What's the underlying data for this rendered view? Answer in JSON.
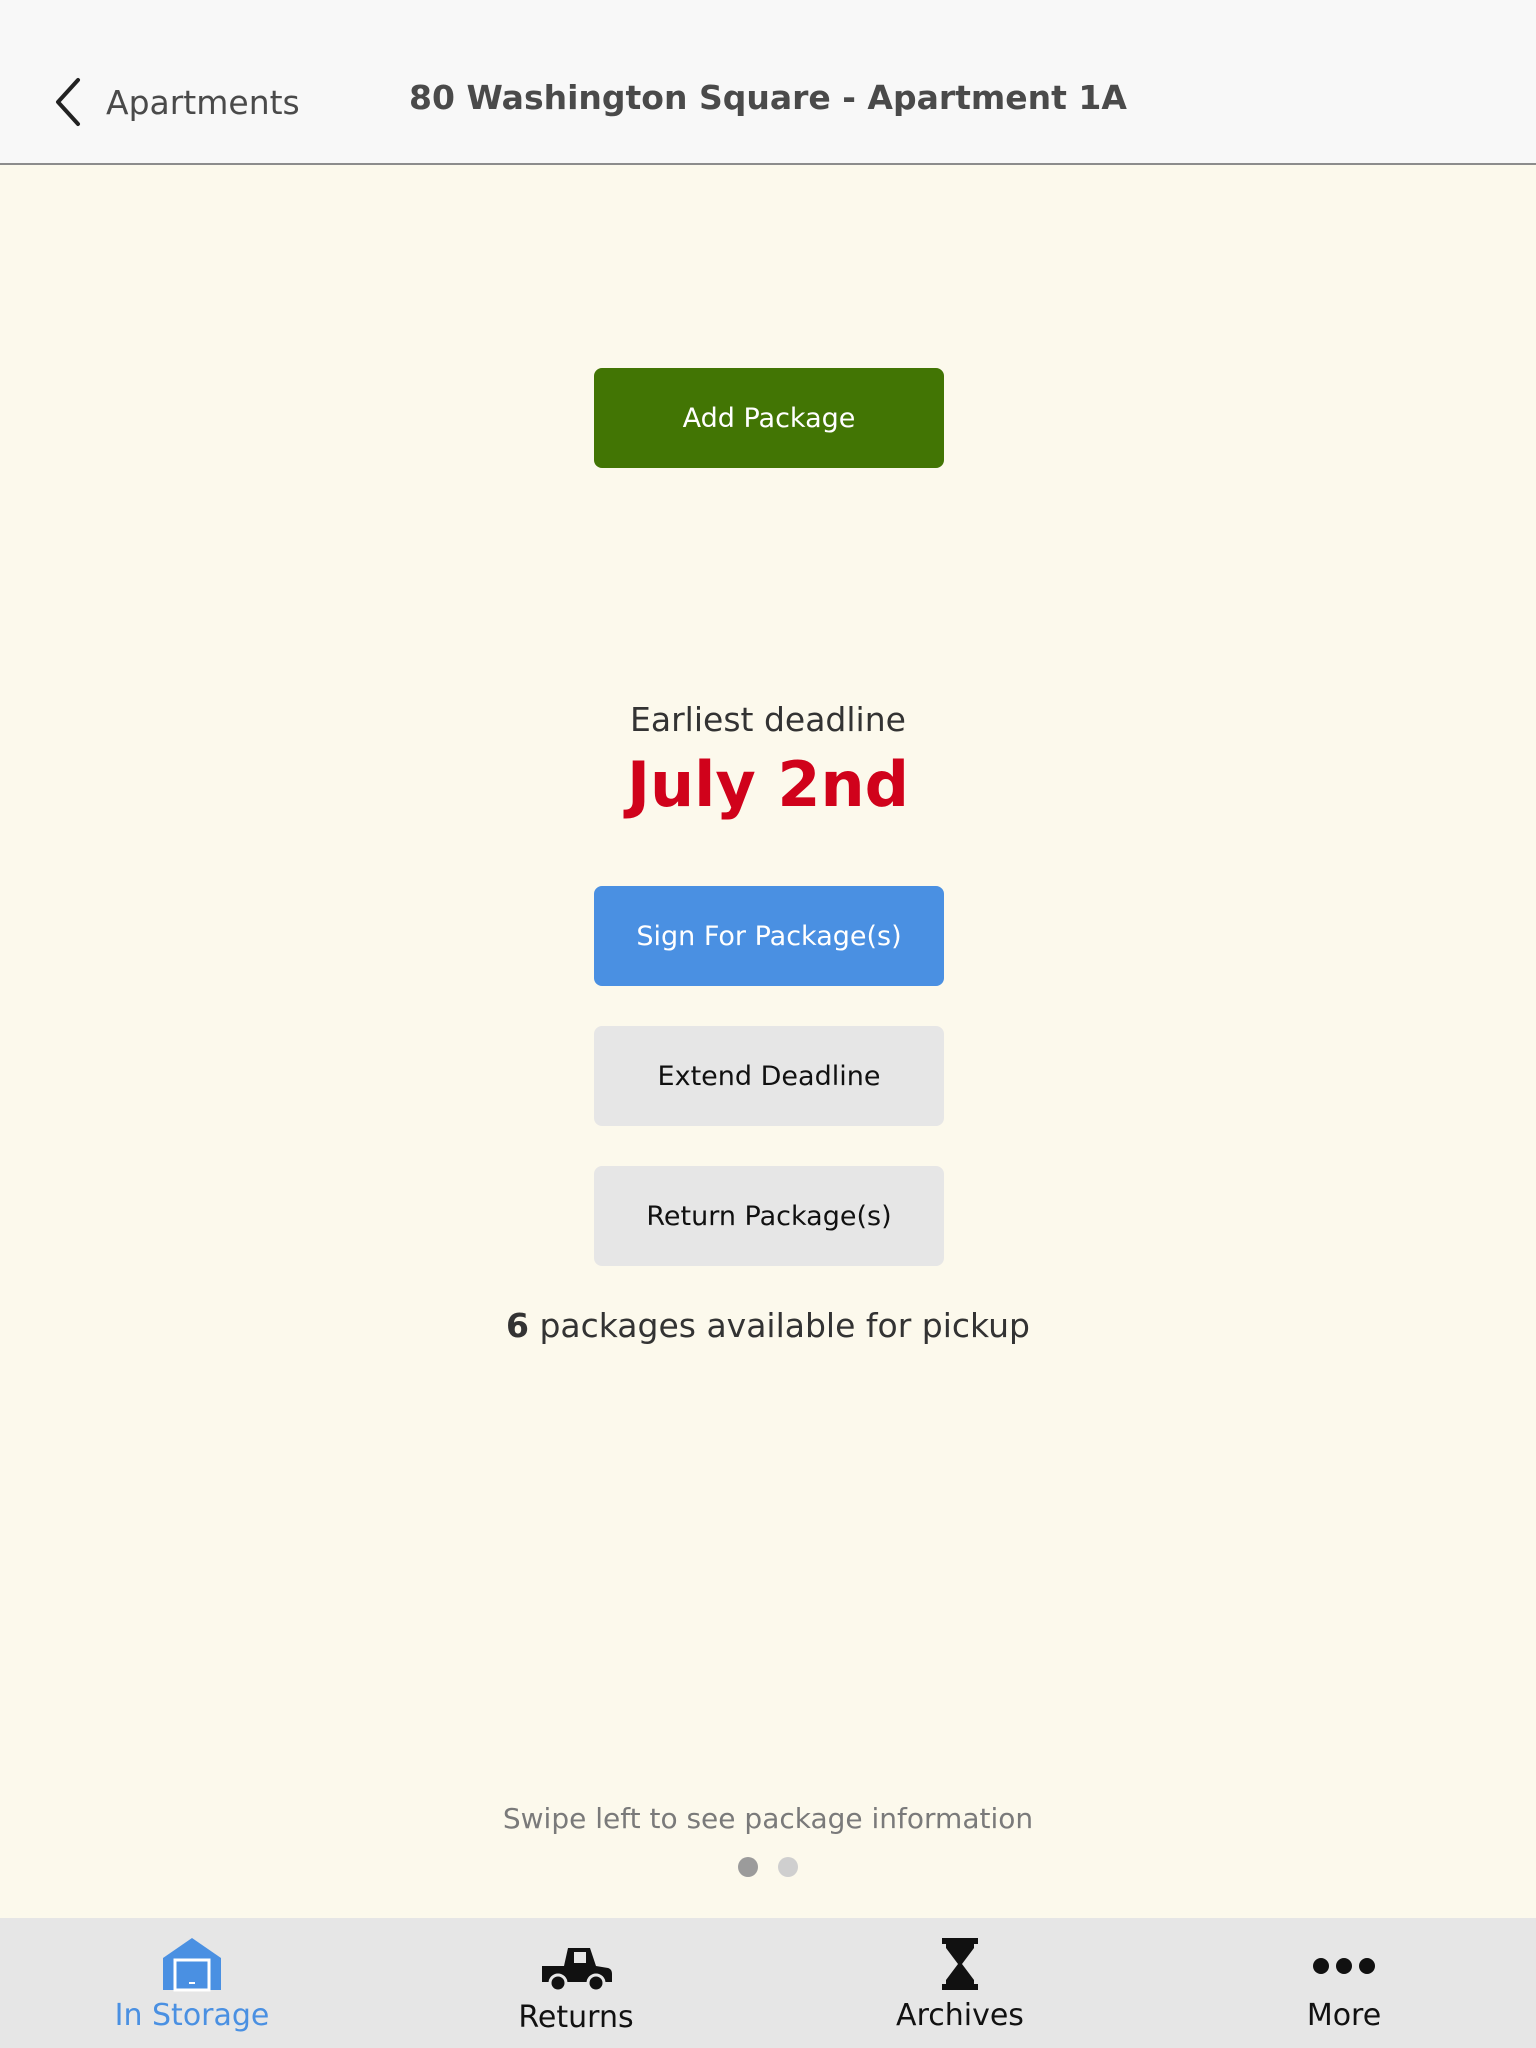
{
  "header": {
    "back_label": "Apartments",
    "title": "80 Washington Square - Apartment 1A"
  },
  "main": {
    "add_package_label": "Add Package",
    "deadline_label": "Earliest deadline",
    "deadline_date": "July 2nd",
    "sign_label": "Sign For Package(s)",
    "extend_label": "Extend Deadline",
    "return_label": "Return Package(s)",
    "pickup_count": "6",
    "pickup_text": " packages available for pickup",
    "swipe_hint": "Swipe left to see package information",
    "page_indicator": {
      "pages": 2,
      "current": 1
    }
  },
  "tabs": [
    {
      "label": "In Storage",
      "icon": "garage-icon",
      "active": true
    },
    {
      "label": "Returns",
      "icon": "truck-icon",
      "active": false
    },
    {
      "label": "Archives",
      "icon": "hourglass-icon",
      "active": false
    },
    {
      "label": "More",
      "icon": "ellipsis-icon",
      "active": false
    }
  ],
  "colors": {
    "add_button": "#427504",
    "sign_button": "#4a90e2",
    "deadline": "#d0021b",
    "active_tab": "#4a90e2",
    "background": "#fcf9ec"
  }
}
